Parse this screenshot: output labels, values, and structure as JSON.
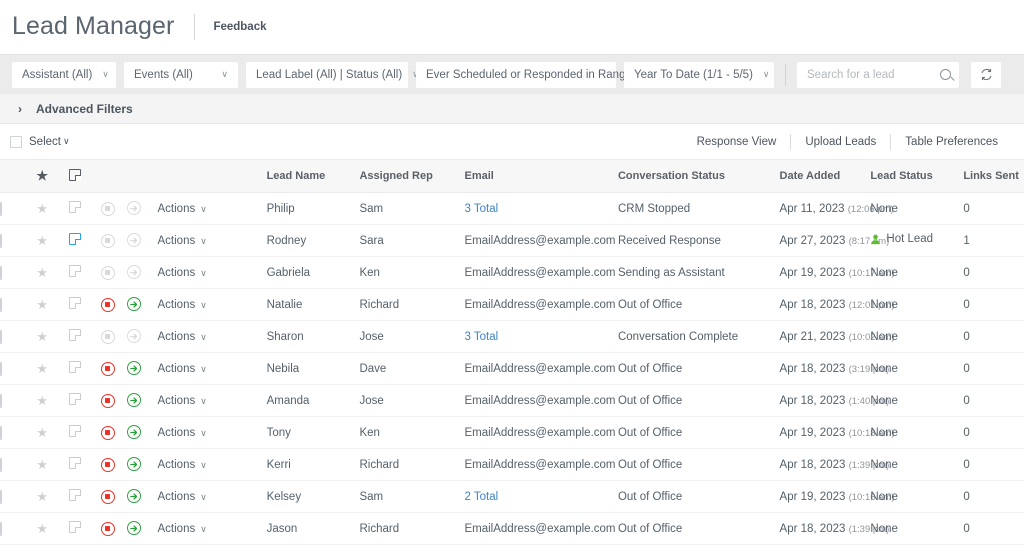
{
  "header": {
    "title": "Lead Manager",
    "feedback_label": "Feedback"
  },
  "filters": {
    "assistant": "Assistant (All)",
    "events": "Events (All)",
    "lead_label_status": "Lead Label (All) | Status (All)",
    "ever_scheduled": "Ever Scheduled or Responded in Range:",
    "date_range": "Year To Date (1/1 - 5/5)",
    "search_value": "",
    "search_placeholder": "Search for a lead",
    "search_icon": "search-icon",
    "refresh_icon": "refresh-icon",
    "caret": "∨"
  },
  "advanced_filters": {
    "chevron": "›",
    "label": "Advanced Filters"
  },
  "select_row": {
    "label": "Select",
    "caret": "∨",
    "actions": [
      {
        "label": "Response View"
      },
      {
        "label": "Upload Leads"
      },
      {
        "label": "Table Preferences"
      }
    ]
  },
  "table": {
    "columns": {
      "check": "",
      "star": "★",
      "note": "note-icon",
      "stop": "",
      "forward": "",
      "actions": "",
      "lead_name": "Lead Name",
      "assigned_rep": "Assigned Rep",
      "email": "Email",
      "conversation_status": "Conversation Status",
      "date_added": "Date Added",
      "lead_status": "Lead Status",
      "links_sent": "Links Sent"
    },
    "actions_label": "Actions",
    "actions_caret": "∨",
    "rows": [
      {
        "note_active": false,
        "controls_enabled": false,
        "lead_name": "Philip",
        "assigned_rep": "Sam",
        "email": "3 Total",
        "email_is_link": true,
        "conversation_status": "CRM Stopped",
        "date": "Apr 11, 2023",
        "time": "(12:06 pm)",
        "lead_status": "None",
        "hot": false,
        "links_sent": "0"
      },
      {
        "note_active": true,
        "controls_enabled": false,
        "lead_name": "Rodney",
        "assigned_rep": "Sara",
        "email": "EmailAddress@example.com",
        "email_is_link": false,
        "conversation_status": "Received Response",
        "date": "Apr 27, 2023",
        "time": "(8:17 am)",
        "lead_status": "Hot Lead",
        "hot": true,
        "links_sent": "1"
      },
      {
        "note_active": false,
        "controls_enabled": false,
        "lead_name": "Gabriela",
        "assigned_rep": "Ken",
        "email": "EmailAddress@example.com",
        "email_is_link": false,
        "conversation_status": "Sending as Assistant",
        "date": "Apr 19, 2023",
        "time": "(10:17 am)",
        "lead_status": "None",
        "hot": false,
        "links_sent": "0"
      },
      {
        "note_active": false,
        "controls_enabled": true,
        "lead_name": "Natalie",
        "assigned_rep": "Richard",
        "email": "EmailAddress@example.com",
        "email_is_link": false,
        "conversation_status": "Out of Office",
        "date": "Apr 18, 2023",
        "time": "(12:01 pm)",
        "lead_status": "None",
        "hot": false,
        "links_sent": "0"
      },
      {
        "note_active": false,
        "controls_enabled": false,
        "lead_name": "Sharon",
        "assigned_rep": "Jose",
        "email": "3 Total",
        "email_is_link": true,
        "conversation_status": "Conversation Complete",
        "date": "Apr 21, 2023",
        "time": "(10:02 am)",
        "lead_status": "None",
        "hot": false,
        "links_sent": "0"
      },
      {
        "note_active": false,
        "controls_enabled": true,
        "lead_name": "Nebila",
        "assigned_rep": "Dave",
        "email": "EmailAddress@example.com",
        "email_is_link": false,
        "conversation_status": "Out of Office",
        "date": "Apr 18, 2023",
        "time": "(3:19 pm)",
        "lead_status": "None",
        "hot": false,
        "links_sent": "0"
      },
      {
        "note_active": false,
        "controls_enabled": true,
        "lead_name": "Amanda",
        "assigned_rep": "Jose",
        "email": "EmailAddress@example.com",
        "email_is_link": false,
        "conversation_status": "Out of Office",
        "date": "Apr 18, 2023",
        "time": "(1:40 pm)",
        "lead_status": "None",
        "hot": false,
        "links_sent": "0"
      },
      {
        "note_active": false,
        "controls_enabled": true,
        "lead_name": "Tony",
        "assigned_rep": "Ken",
        "email": "EmailAddress@example.com",
        "email_is_link": false,
        "conversation_status": "Out of Office",
        "date": "Apr 19, 2023",
        "time": "(10:18 am)",
        "lead_status": "None",
        "hot": false,
        "links_sent": "0"
      },
      {
        "note_active": false,
        "controls_enabled": true,
        "lead_name": "Kerri",
        "assigned_rep": "Richard",
        "email": "EmailAddress@example.com",
        "email_is_link": false,
        "conversation_status": "Out of Office",
        "date": "Apr 18, 2023",
        "time": "(1:39 pm)",
        "lead_status": "None",
        "hot": false,
        "links_sent": "0"
      },
      {
        "note_active": false,
        "controls_enabled": true,
        "lead_name": "Kelsey",
        "assigned_rep": "Sam",
        "email": "2 Total",
        "email_is_link": true,
        "conversation_status": "Out of Office",
        "date": "Apr 19, 2023",
        "time": "(10:16 am)",
        "lead_status": "None",
        "hot": false,
        "links_sent": "0"
      },
      {
        "note_active": false,
        "controls_enabled": true,
        "lead_name": "Jason",
        "assigned_rep": "Richard",
        "email": "EmailAddress@example.com",
        "email_is_link": false,
        "conversation_status": "Out of Office",
        "date": "Apr 18, 2023",
        "time": "(1:39 pm)",
        "lead_status": "None",
        "hot": false,
        "links_sent": "0"
      }
    ]
  },
  "colors": {
    "stop": "#e8342b",
    "forward": "#2d9e3f",
    "note_active": "#22a7e0",
    "link": "#3f83c4",
    "hot_lead": "#5bbd2a"
  }
}
